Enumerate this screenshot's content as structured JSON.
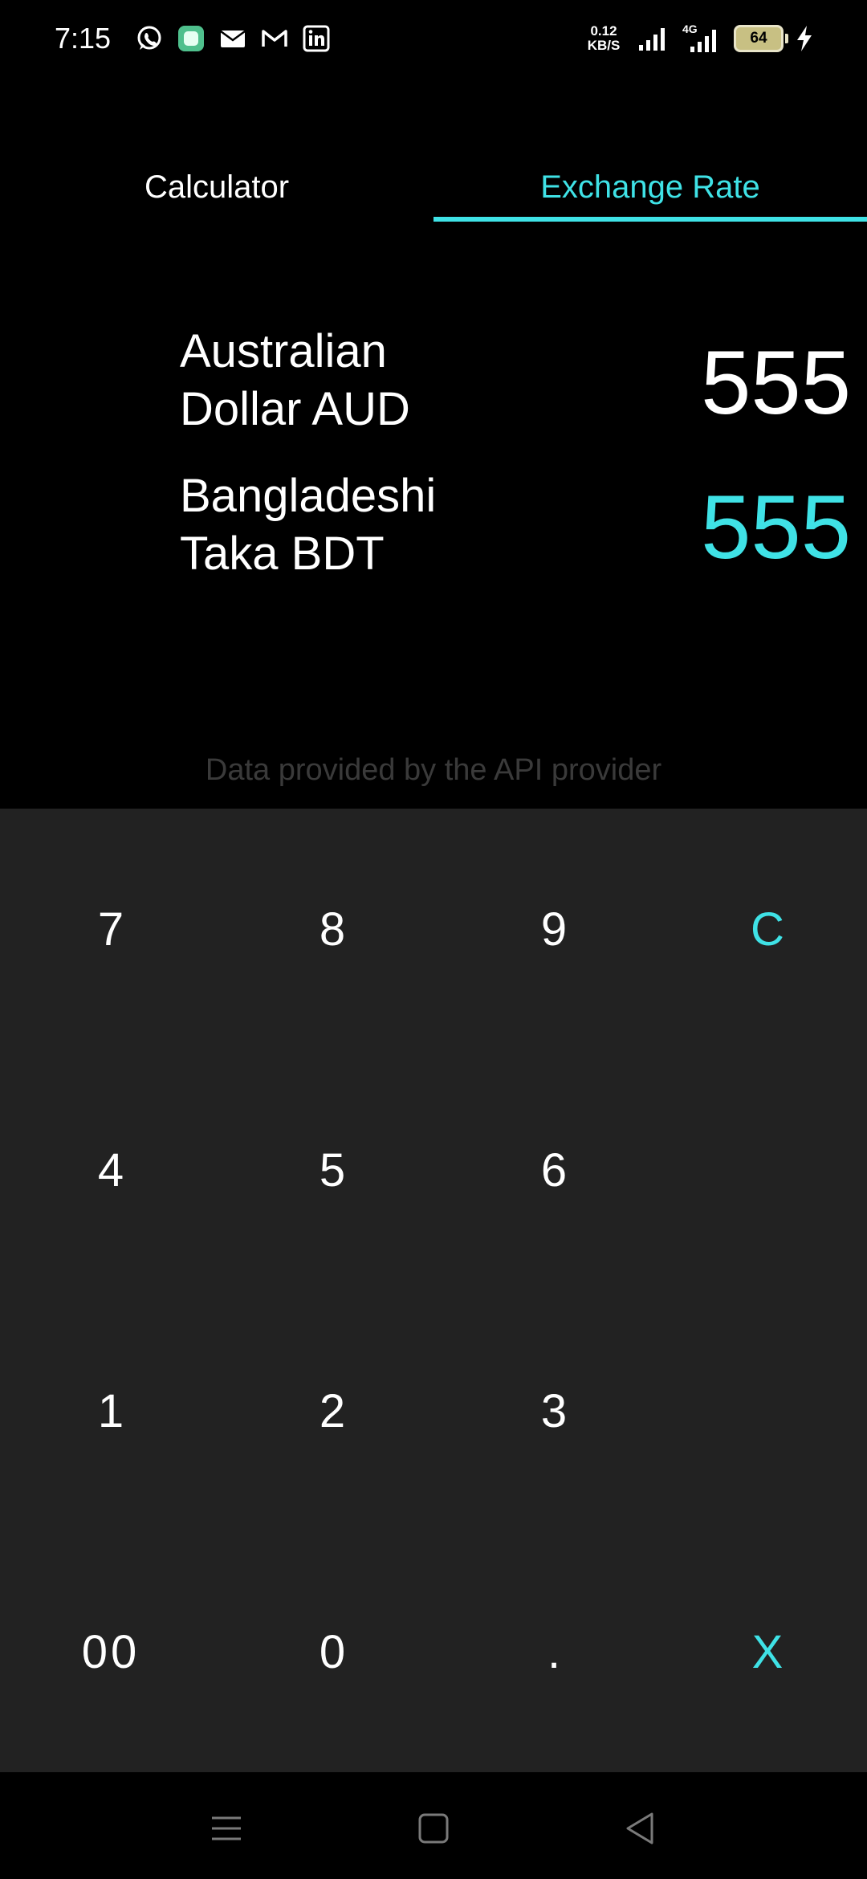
{
  "status_bar": {
    "time": "7:15",
    "notification_icons": [
      "whatsapp-icon",
      "app-icon",
      "email-icon",
      "gmail-icon",
      "linkedin-icon"
    ],
    "net_speed_value": "0.12",
    "net_speed_unit": "KB/S",
    "network_type": "4G",
    "battery_level": "64"
  },
  "tabs": [
    {
      "label": "Calculator",
      "active": false
    },
    {
      "label": "Exchange Rate",
      "active": true
    }
  ],
  "exchange": {
    "from": {
      "line1": "Australian",
      "line2": "Dollar AUD",
      "value": "555"
    },
    "to": {
      "line1": "Bangladeshi",
      "line2": "Taka BDT",
      "value": "555"
    },
    "provider_note": "Data provided by the API provider"
  },
  "keypad": {
    "keys": [
      "7",
      "8",
      "9",
      "C",
      "4",
      "5",
      "6",
      "1",
      "2",
      "3",
      "00",
      "0",
      ".",
      "X"
    ]
  },
  "nav_bar": {
    "buttons": [
      "menu-icon",
      "home-icon",
      "back-icon"
    ]
  },
  "colors": {
    "accent": "#3fe2e6",
    "background": "#000000",
    "keypad_background": "#222222",
    "provider_note": "#3a3a3a"
  }
}
